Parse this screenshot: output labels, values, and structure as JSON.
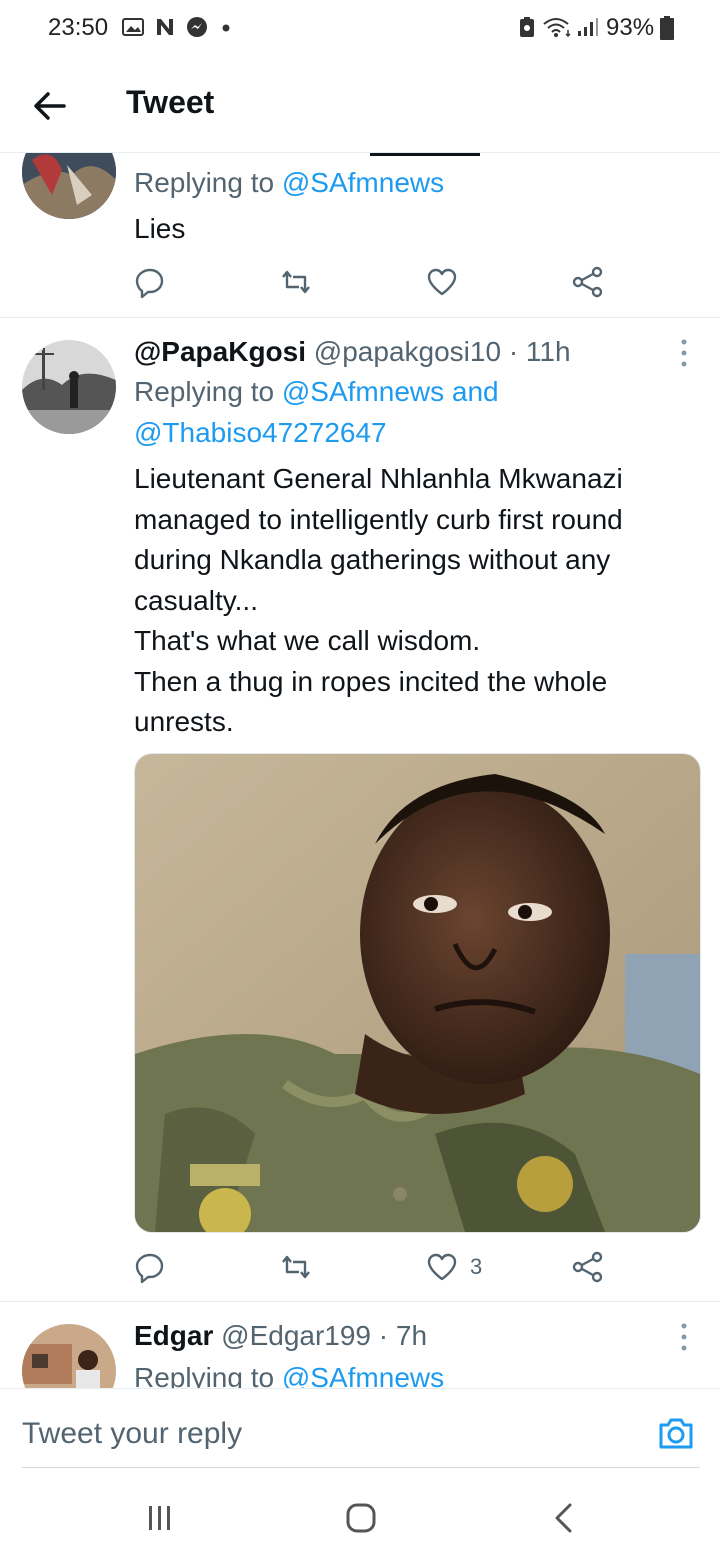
{
  "status_bar": {
    "time": "23:50",
    "battery": "93%"
  },
  "header": {
    "title": "Tweet"
  },
  "tweets": [
    {
      "replying_prefix": "Replying to ",
      "replying_to": "@SAfmnews",
      "text": "Lies",
      "like_count": ""
    },
    {
      "display_name": "@PapaKgosi",
      "handle": "@papakgosi10",
      "time": "11h",
      "replying_prefix": "Replying to ",
      "replying_to_1": "@SAfmnews and",
      "replying_to_2": "@Thabiso47272647",
      "text_lines": [
        "Lieutenant General Nhlanhla Mkwanazi",
        "managed to intelligently curb first round",
        "during Nkandla gatherings without any",
        "casualty...",
        "That's what we call wisdom.",
        "Then a thug in ropes incited the whole",
        "unrests."
      ],
      "like_count": "3"
    },
    {
      "display_name": "Edgar",
      "handle": "@Edgar199",
      "time": "7h",
      "replying_prefix": "Replying to ",
      "replying_to": "@SAfmnews"
    }
  ],
  "reply_bar": {
    "placeholder": "Tweet your reply"
  },
  "icons": {
    "back": "arrow-left-icon",
    "reply": "reply-icon",
    "retweet": "retweet-icon",
    "like": "heart-icon",
    "share": "share-icon",
    "more": "more-vertical-icon",
    "camera": "camera-icon"
  },
  "colors": {
    "link": "#1d9bf0",
    "secondary_text": "#536471",
    "divider": "#e6ecf0"
  }
}
